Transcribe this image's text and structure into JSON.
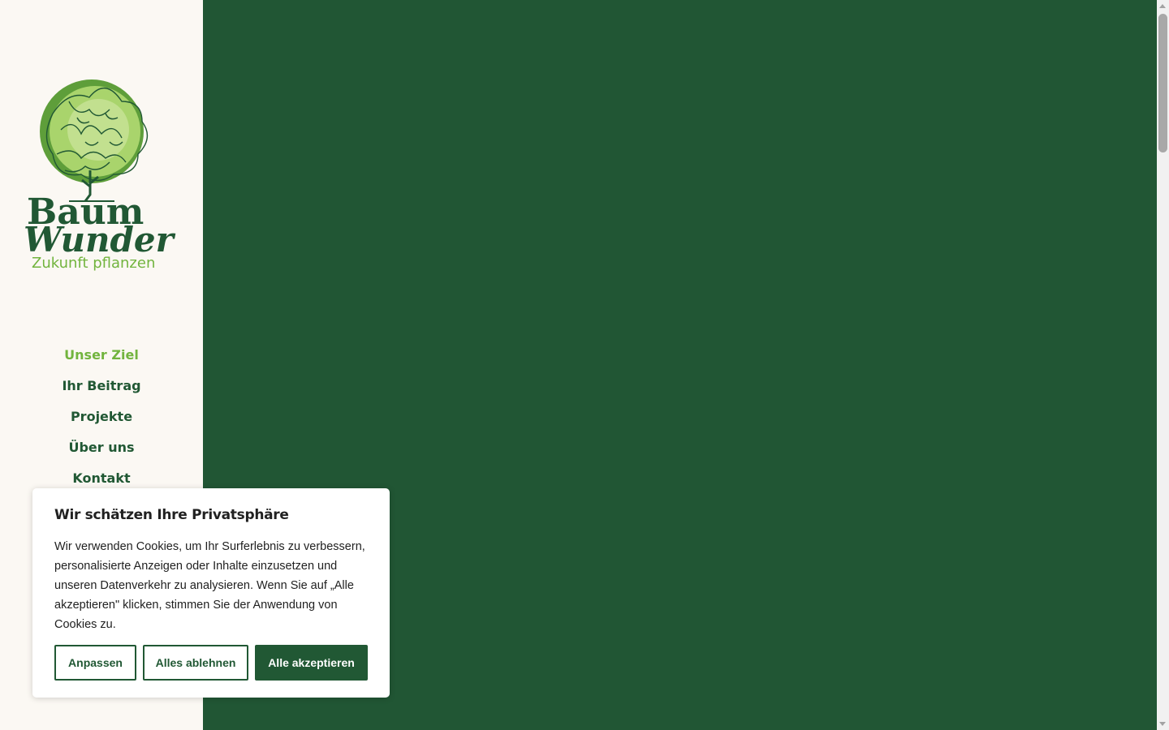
{
  "brand": {
    "name_line1": "Baum",
    "name_line2": "Wunder",
    "tagline": "Zukunft pflanzen",
    "colors": {
      "dark_green": "#215834",
      "light_green": "#72b43e",
      "background": "#fbf8f3"
    }
  },
  "nav": {
    "items": [
      {
        "label": "Unser Ziel",
        "active": true
      },
      {
        "label": "Ihr Beitrag",
        "active": false
      },
      {
        "label": "Projekte",
        "active": false
      },
      {
        "label": "Über uns",
        "active": false
      },
      {
        "label": "Kontakt",
        "active": false
      }
    ]
  },
  "cookie_banner": {
    "title": "Wir schätzen Ihre Privatsphäre",
    "text": "Wir verwenden Cookies, um Ihr Surferlebnis zu verbessern, personalisierte Anzeigen oder Inhalte einzusetzen und unseren Datenverkehr zu analysieren. Wenn Sie auf „Alle akzeptieren\" klicken, stimmen Sie der Anwendung von Cookies zu.",
    "customize_label": "Anpassen",
    "reject_label": "Alles ablehnen",
    "accept_label": "Alle akzeptieren"
  }
}
